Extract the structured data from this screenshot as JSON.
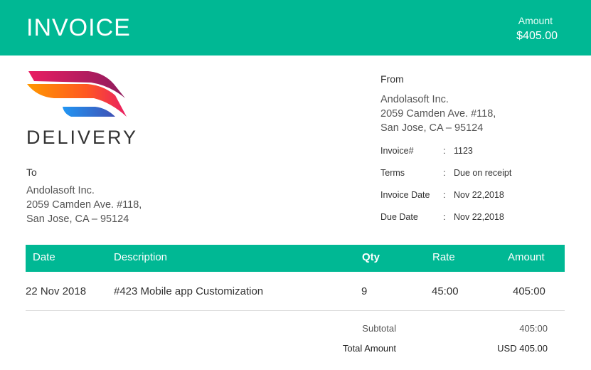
{
  "header": {
    "title": "INVOICE",
    "amount_label": "Amount",
    "amount_value": "$405.00"
  },
  "brand": {
    "name": "DELIVERY",
    "logo_icon": "delivery-wing-logo",
    "colors": [
      "#e91e63",
      "#ff5722",
      "#ff9800",
      "#3f51b5"
    ]
  },
  "to": {
    "label": "To",
    "company": "Andolasoft Inc.",
    "street": "2059 Camden Ave. #118,",
    "city": "San Jose, CA – 95124"
  },
  "from": {
    "label": "From",
    "company": "Andolasoft Inc.",
    "street": "2059 Camden Ave. #118,",
    "city": "San Jose, CA – 95124"
  },
  "meta": [
    {
      "key": "Invoice#",
      "value": "1123"
    },
    {
      "key": "Terms",
      "value": "Due on receipt"
    },
    {
      "key": "Invoice Date",
      "value": "Nov 22,2018"
    },
    {
      "key": "Due Date",
      "value": "Nov 22,2018"
    }
  ],
  "table": {
    "headers": {
      "date": "Date",
      "description": "Description",
      "qty": "Qty",
      "rate": "Rate",
      "amount": "Amount"
    },
    "rows": [
      {
        "date": "22 Nov 2018",
        "description": "#423 Mobile app Customization",
        "qty": "9",
        "rate": "45:00",
        "amount": "405:00"
      }
    ]
  },
  "summary": {
    "subtotal_label": "Subtotal",
    "subtotal_value": "405:00",
    "total_label": "Total Amount",
    "total_value": "USD 405.00"
  },
  "colors": {
    "accent": "#00b894"
  }
}
